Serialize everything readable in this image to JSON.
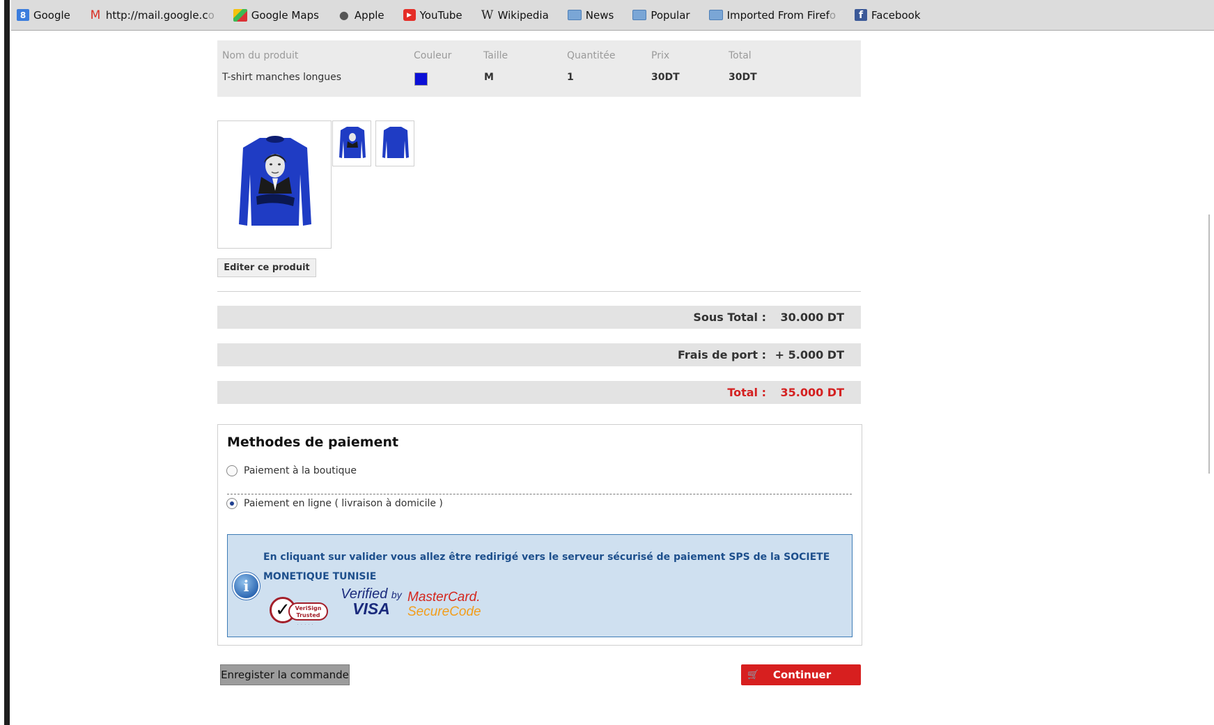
{
  "bookmarks": [
    {
      "label": "Google",
      "icon": "google-icon"
    },
    {
      "label": "http://mail.google.c",
      "label_faded": "o",
      "icon": "gmail-icon"
    },
    {
      "label": "Google Maps",
      "icon": "google-maps-icon"
    },
    {
      "label": "Apple",
      "icon": "apple-icon"
    },
    {
      "label": "YouTube",
      "icon": "youtube-icon"
    },
    {
      "label": "Wikipedia",
      "icon": "wikipedia-icon"
    },
    {
      "label": "News",
      "icon": "folder-icon"
    },
    {
      "label": "Popular",
      "icon": "folder-icon"
    },
    {
      "label": "Imported From Firef",
      "label_faded": "o",
      "icon": "folder-icon"
    },
    {
      "label": "Facebook",
      "icon": "facebook-icon"
    }
  ],
  "cart": {
    "headers": {
      "name": "Nom du produit",
      "color": "Couleur",
      "size": "Taille",
      "qty": "Quantitée",
      "price": "Prix",
      "total": "Total"
    },
    "row": {
      "name": "T-shirt manches longues",
      "color_hex": "#0b10d6",
      "size": "M",
      "qty": "1",
      "price": "30DT",
      "total": "30DT"
    }
  },
  "product": {
    "shirt_color": "#1f3cc4",
    "edit_label": "Editer ce produit"
  },
  "summary": {
    "subtotal_label": "Sous Total :",
    "subtotal_value": "30.000 DT",
    "shipping_label": "Frais de port :",
    "shipping_value": "+ 5.000 DT",
    "total_label": "Total :",
    "total_value": "35.000 DT",
    "total_color": "#d42121"
  },
  "payment": {
    "title": "Methodes de paiement",
    "options": [
      {
        "label": "Paiement à la boutique",
        "selected": false
      },
      {
        "label": "Paiement en ligne ( livraison à domicile )",
        "selected": true
      }
    ],
    "info_text": "En cliquant sur valider vous allez être redirigé vers le serveur sécurisé de paiement SPS de la SOCIETE MONETIQUE TUNISIE",
    "logos": {
      "verisign_line1": "VeriSign",
      "verisign_line2": "Trusted",
      "vbv_verified": "Verified",
      "vbv_by": "by",
      "vbv_visa": "VISA",
      "mc_line1": "MasterCard.",
      "mc_line2": "SecureCode"
    }
  },
  "actions": {
    "save_label": "Enregister la commande",
    "continue_label": "Continuer"
  }
}
